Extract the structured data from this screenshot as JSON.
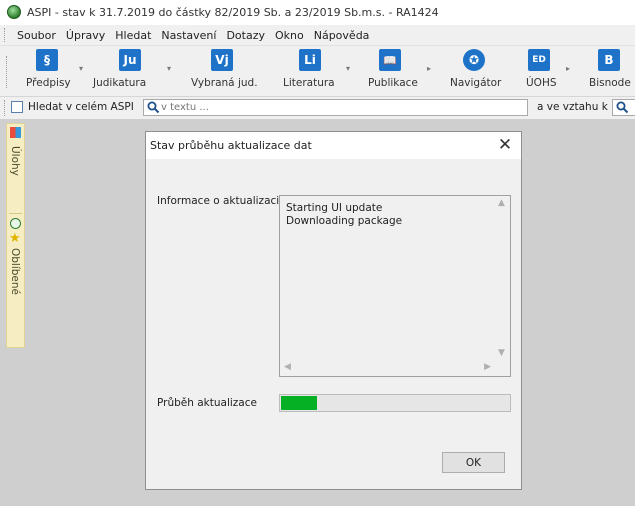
{
  "window": {
    "title": "ASPI  - stav k 31.7.2019 do částky 82/2019 Sb. a 23/2019 Sb.m.s. - RA1424"
  },
  "menu": {
    "items": [
      "Soubor",
      "Úpravy",
      "Hledat",
      "Nastavení",
      "Dotazy",
      "Okno",
      "Nápověda"
    ]
  },
  "toolbar": {
    "buttons": [
      {
        "label": "Předpisy",
        "icon_text": "§",
        "icon": "paragraph-icon"
      },
      {
        "label": "Judikatura",
        "icon_text": "Ju",
        "icon": "judikatura-icon"
      },
      {
        "label": "Vybraná jud.",
        "icon_text": "Vj",
        "icon": "vybrana-judikatura-icon"
      },
      {
        "label": "Literatura",
        "icon_text": "Li",
        "icon": "literatura-icon"
      },
      {
        "label": "Publikace",
        "icon_text": "📖",
        "icon": "book-icon"
      },
      {
        "label": "Navigátor",
        "icon_text": "✪",
        "icon": "compass-icon"
      },
      {
        "label": "ÚOHS",
        "icon_text": "ED",
        "icon": "uohs-icon"
      },
      {
        "label": "Bisnode",
        "icon_text": "B",
        "icon": "bisnode-icon"
      }
    ]
  },
  "search": {
    "scope_label": "Hledat v celém ASPI",
    "placeholder": "v textu ...",
    "relation_label": "a ve vztahu k"
  },
  "sidebar": {
    "tabs": [
      {
        "label": "Úlohy"
      },
      {
        "label": "Oblíbené"
      }
    ]
  },
  "dialog": {
    "title": "Stav průběhu aktualizace dat",
    "close_glyph": "✕",
    "info_label": "Informace o aktualizaci",
    "log_lines": [
      "Starting UI update",
      "Downloading package"
    ],
    "progress_label": "Průběh aktualizace",
    "progress_value": 0.16,
    "ok_label": "OK"
  },
  "colors": {
    "progress_fill": "#06b025",
    "toolbar_icon_blue": "#1e73c8",
    "workspace_bg": "#cfcfcf",
    "sidebar_bg": "#f7edc2"
  }
}
